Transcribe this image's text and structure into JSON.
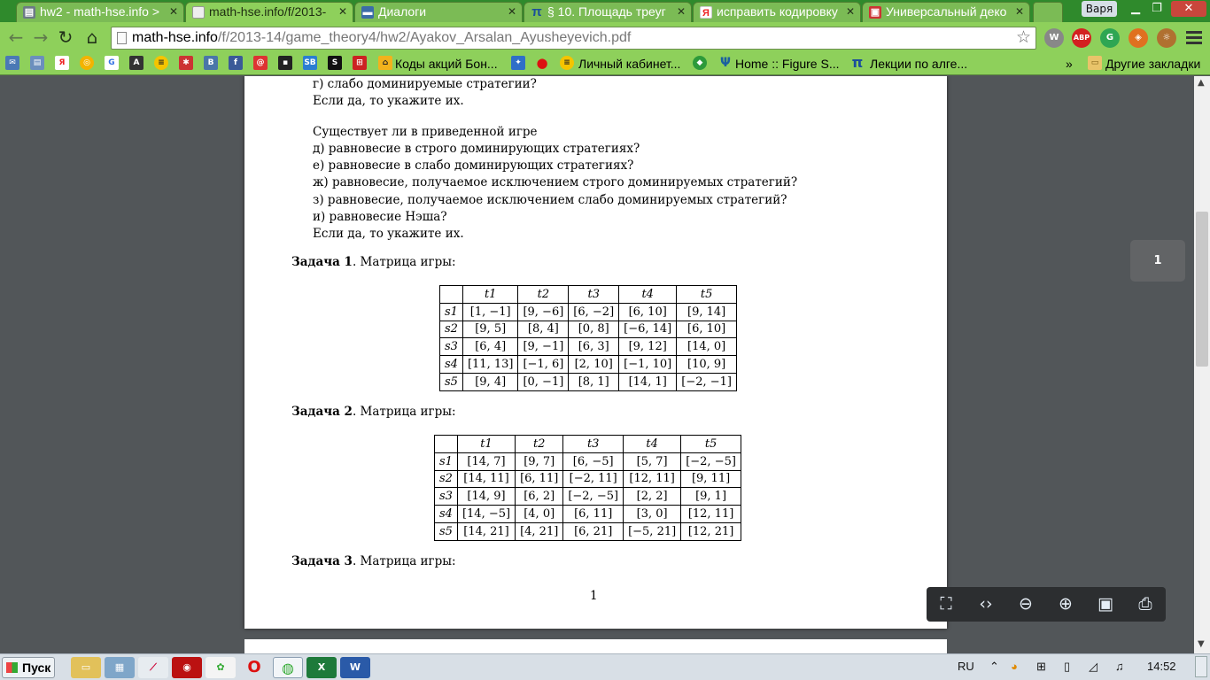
{
  "browser": {
    "tabs": [
      {
        "title": "hw2 - math-hse.info >",
        "icon": "folder-icon",
        "active": false
      },
      {
        "title": "math-hse.info/f/2013-",
        "icon": "page-icon",
        "active": true
      },
      {
        "title": "Диалоги",
        "icon": "chat-icon",
        "active": false
      },
      {
        "title": "§ 10. Площадь треуг",
        "icon": "pi-icon",
        "active": false
      },
      {
        "title": "исправить кодировку",
        "icon": "yandex-icon",
        "active": false
      },
      {
        "title": "Универсальный деко",
        "icon": "decoder-icon",
        "active": false
      }
    ],
    "user_name": "Варя",
    "url_host": "math-hse.info",
    "url_path": "/f/2013-14/game_theory4/hw2/Ayakov_Arsalan_Ayusheyevich.pdf",
    "extensions": [
      "W",
      "ABP",
      "G",
      "◈",
      "☼"
    ]
  },
  "bookmarks": [
    {
      "label": "Коды акций Бон..."
    },
    {
      "label": "Личный кабинет..."
    },
    {
      "label": "Home :: Figure S..."
    },
    {
      "label": "Лекции по алге..."
    },
    {
      "label": "»"
    },
    {
      "label": "Другие закладки"
    }
  ],
  "pdf": {
    "lines_top": [
      "г) слабо доминируемые стратегии?",
      "Если да, то укажите их."
    ],
    "question_intro": "Существует ли в приведенной игре",
    "questions": [
      "д) равновесие в строго доминирующих стратегиях?",
      "е) равновесие в слабо доминирующих стратегиях?",
      "ж) равновесие, получаемое исключением строго доминируемых стратегий?",
      "з) равновесие, получаемое исключением слабо доминируемых стратегий?",
      "и) равновесие Нэша?",
      "Если да, то укажите их."
    ],
    "tasks": [
      {
        "label": "Задача 1",
        "text": ". Матрица игры:",
        "cols": [
          "t1",
          "t2",
          "t3",
          "t4",
          "t5"
        ],
        "rows": [
          {
            "h": "s1",
            "cells": [
              "[1, −1]",
              "[9, −6]",
              "[6, −2]",
              "[6, 10]",
              "[9, 14]"
            ]
          },
          {
            "h": "s2",
            "cells": [
              "[9, 5]",
              "[8, 4]",
              "[0, 8]",
              "[−6, 14]",
              "[6, 10]"
            ]
          },
          {
            "h": "s3",
            "cells": [
              "[6, 4]",
              "[9, −1]",
              "[6, 3]",
              "[9, 12]",
              "[14, 0]"
            ]
          },
          {
            "h": "s4",
            "cells": [
              "[11, 13]",
              "[−1, 6]",
              "[2, 10]",
              "[−1, 10]",
              "[10, 9]"
            ]
          },
          {
            "h": "s5",
            "cells": [
              "[9, 4]",
              "[0, −1]",
              "[8, 1]",
              "[14, 1]",
              "[−2, −1]"
            ]
          }
        ]
      },
      {
        "label": "Задача 2",
        "text": ". Матрица игры:",
        "cols": [
          "t1",
          "t2",
          "t3",
          "t4",
          "t5"
        ],
        "rows": [
          {
            "h": "s1",
            "cells": [
              "[14, 7]",
              "[9, 7]",
              "[6, −5]",
              "[5, 7]",
              "[−2, −5]"
            ]
          },
          {
            "h": "s2",
            "cells": [
              "[14, 11]",
              "[6, 11]",
              "[−2, 11]",
              "[12, 11]",
              "[9, 11]"
            ]
          },
          {
            "h": "s3",
            "cells": [
              "[14, 9]",
              "[6, 2]",
              "[−2, −5]",
              "[2, 2]",
              "[9, 1]"
            ]
          },
          {
            "h": "s4",
            "cells": [
              "[14, −5]",
              "[4, 0]",
              "[6, 11]",
              "[3, 0]",
              "[12, 11]"
            ]
          },
          {
            "h": "s5",
            "cells": [
              "[14, 21]",
              "[4, 21]",
              "[6, 21]",
              "[−5, 21]",
              "[12, 21]"
            ]
          }
        ]
      },
      {
        "label": "Задача 3",
        "text": ". Матрица игры:"
      }
    ],
    "page_number": "1"
  },
  "viewer": {
    "page_indicator": "1"
  },
  "taskbar": {
    "start_label": "Пуск",
    "language": "RU",
    "clock": "14:52"
  }
}
